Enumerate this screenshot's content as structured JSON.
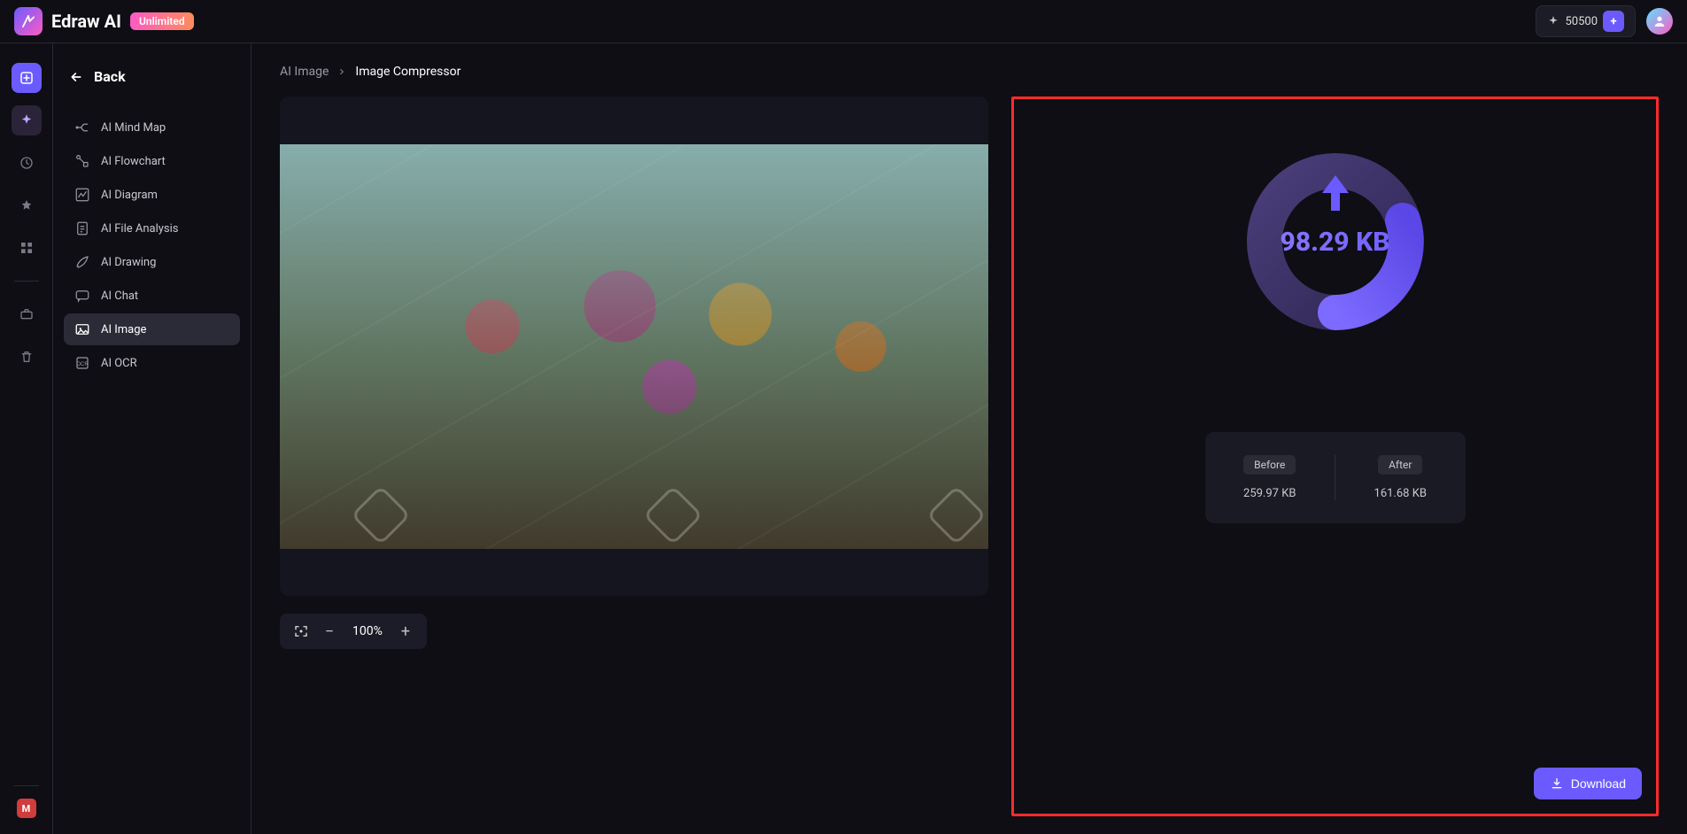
{
  "header": {
    "app_name": "Edraw AI",
    "badge": "Unlimited",
    "credits": "50500"
  },
  "rail": {
    "bottom_initial": "M"
  },
  "sidebar": {
    "back": "Back",
    "items": [
      {
        "label": "AI Mind Map"
      },
      {
        "label": "AI Flowchart"
      },
      {
        "label": "AI Diagram"
      },
      {
        "label": "AI File Analysis"
      },
      {
        "label": "AI Drawing"
      },
      {
        "label": "AI Chat"
      },
      {
        "label": "AI Image"
      },
      {
        "label": "AI OCR"
      }
    ]
  },
  "breadcrumb": {
    "root": "AI Image",
    "current": "Image Compressor"
  },
  "zoom": {
    "value": "100%"
  },
  "result": {
    "saved": "98.29 KB",
    "before_label": "Before",
    "before_value": "259.97 KB",
    "after_label": "After",
    "after_value": "161.68 KB",
    "download": "Download"
  }
}
